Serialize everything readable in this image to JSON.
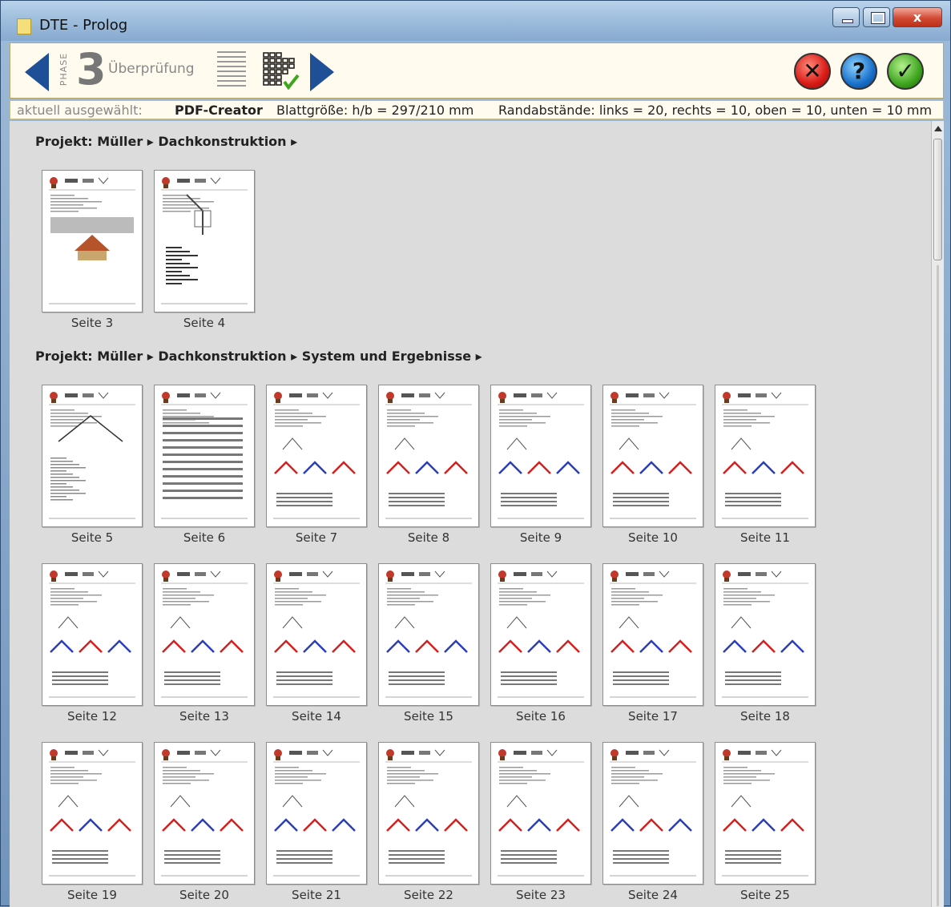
{
  "window": {
    "title": "DTE - Prolog",
    "close_glyph": "x"
  },
  "toolbar": {
    "phase_label": "PHASE",
    "phase_number": "3",
    "phase_title": "Überprüfung",
    "icons": [
      "arrow-left-icon",
      "list-icon",
      "grid-check-icon",
      "arrow-right-icon",
      "cancel-icon",
      "help-icon",
      "confirm-icon"
    ],
    "cancel_glyph": "✕",
    "help_glyph": "?",
    "ok_glyph": "✓"
  },
  "status": {
    "label": "aktuell ausgewählt:",
    "printer": "PDF-Creator",
    "page_size": "Blattgröße: h/b = 297/210 mm",
    "margins": "Randabstände: links = 20, rechts = 10, oben = 10, unten = 10 mm"
  },
  "sections": [
    {
      "title": "Projekt: Müller ▸ Dachkonstruktion ▸",
      "pages": [
        "Seite 3",
        "Seite 4"
      ]
    },
    {
      "title": "Projekt: Müller ▸ Dachkonstruktion ▸ System und Ergebnisse ▸",
      "pages": [
        "Seite 5",
        "Seite 6",
        "Seite 7",
        "Seite 8",
        "Seite 9",
        "Seite 10",
        "Seite 11",
        "Seite 12",
        "Seite 13",
        "Seite 14",
        "Seite 15",
        "Seite 16",
        "Seite 17",
        "Seite 18",
        "Seite 19",
        "Seite 20",
        "Seite 21",
        "Seite 22",
        "Seite 23",
        "Seite 24",
        "Seite 25"
      ]
    }
  ],
  "colors": {
    "nav_arrow": "#1f4f97",
    "cancel": "#d81b16",
    "help": "#1970c9",
    "ok": "#3ea51f",
    "roof_red": "#d42020",
    "roof_blue": "#2c3fb3"
  }
}
